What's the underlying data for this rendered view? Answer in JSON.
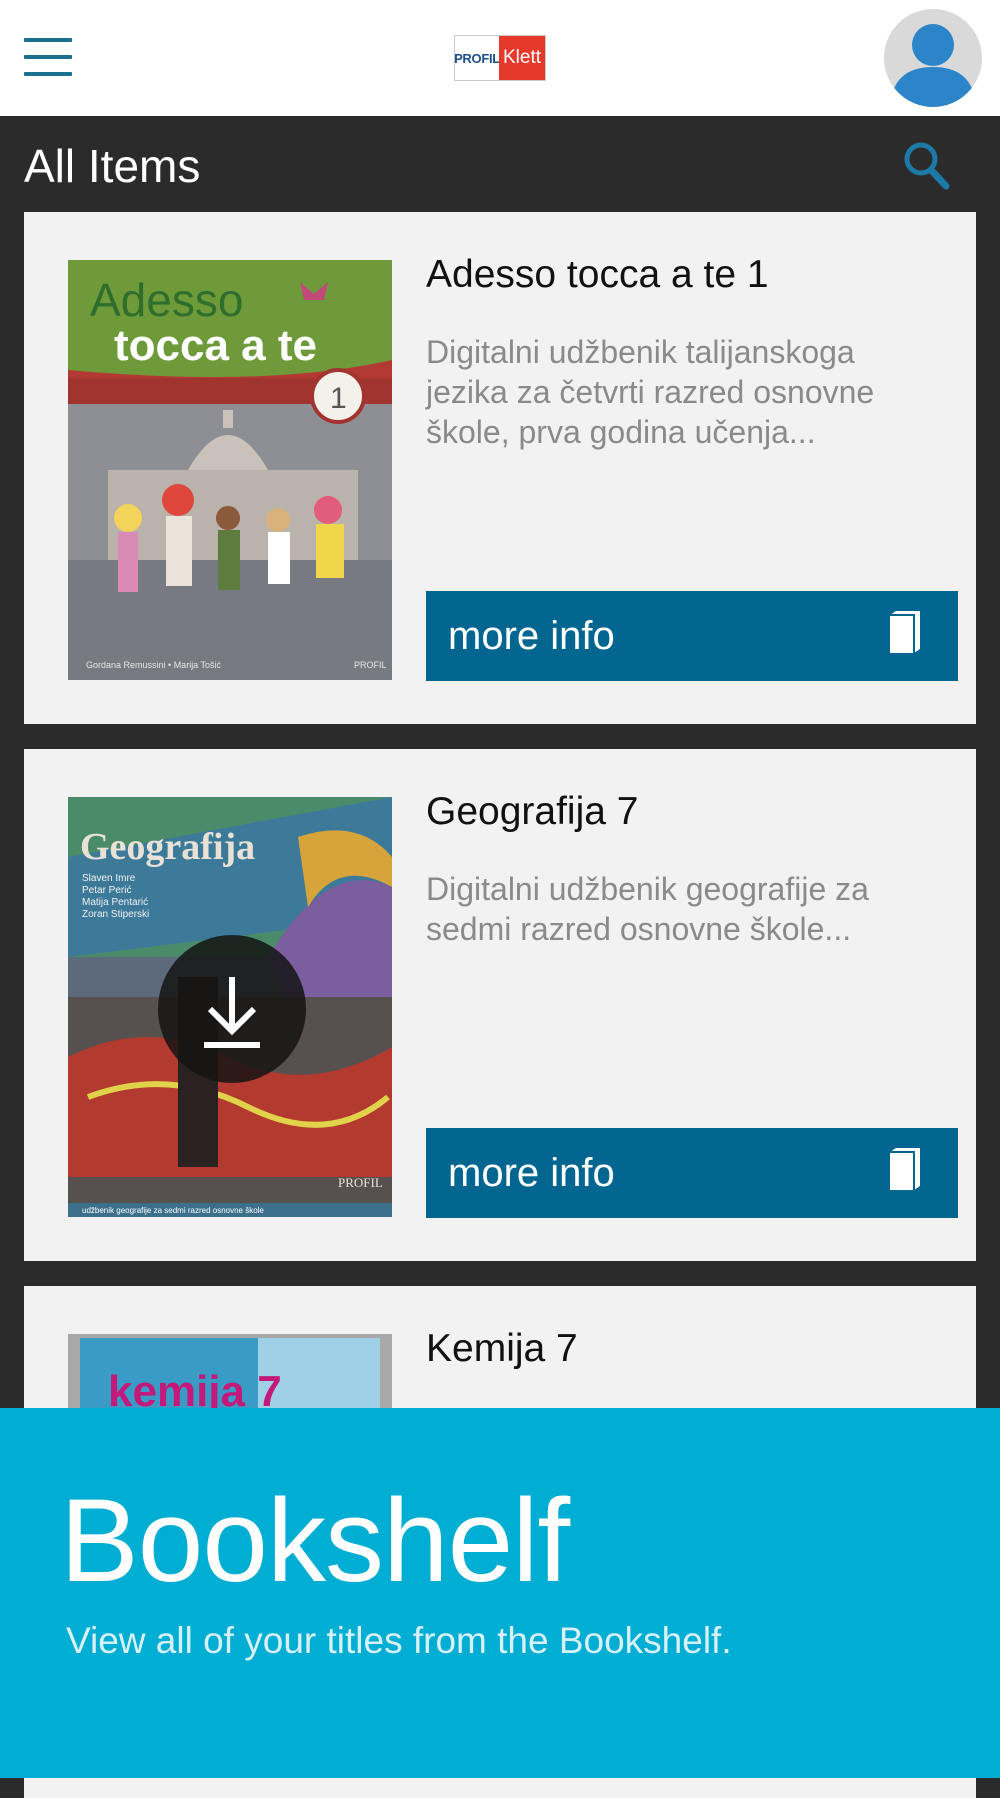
{
  "topbar": {
    "logo_left": "PROFIL",
    "logo_right": "Klett",
    "menu_icon": "hamburger-icon",
    "avatar_icon": "user-avatar-icon"
  },
  "header": {
    "title": "All Items",
    "search_icon": "search-icon"
  },
  "items": [
    {
      "title": "Adesso tocca a te 1",
      "description": "Digitalni udžbenik talijanskoga jezika za četvrti razred osnovne škole, prva  godina učenja...",
      "button_label": "more info",
      "cover": {
        "title_line1": "Adesso",
        "title_line2": "tocca a te",
        "number": "1",
        "authors": "Gordana Remussini  •  Marija Tošić",
        "publisher": "PROFIL"
      }
    },
    {
      "title": "Geografija 7",
      "description": "Digitalni udžbenik geografije za sedmi razred osnovne škole...",
      "button_label": "more info",
      "cover": {
        "title": "Geografija",
        "authors": [
          "Slaven Imre",
          "Petar Perić",
          "Matija Pentarić",
          "Zoran Stiperski"
        ],
        "publisher": "PROFIL",
        "footer": "udžbenik geografije za sedmi razred osnovne škole"
      },
      "download_icon": "download-icon"
    },
    {
      "title": "Kemija 7",
      "cover": {
        "title": "kemija 7"
      }
    }
  ],
  "banner": {
    "title": "Bookshelf",
    "subtitle": "View all of your titles from the Bookshelf."
  },
  "colors": {
    "primary": "#036690",
    "banner": "#00add3",
    "background": "#2b2b2b",
    "card": "#f2f2f2"
  }
}
